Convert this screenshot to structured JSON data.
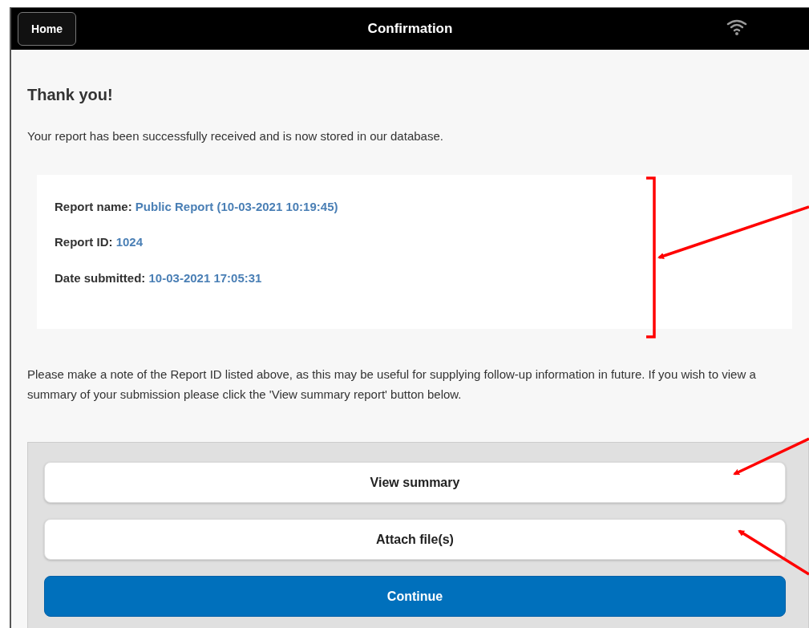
{
  "header": {
    "home_button": "Home",
    "title": "Confirmation"
  },
  "heading": "Thank you!",
  "message": "Your report has been successfully received and is now stored in our database.",
  "details": [
    {
      "label": "Report name:",
      "value": "Public Report (10-03-2021 10:19:45)"
    },
    {
      "label": "Report ID:",
      "value": "1024"
    },
    {
      "label": "Date submitted:",
      "value": "10-03-2021 17:05:31"
    }
  ],
  "note": "Please make a note of the Report ID listed above, as this may be useful for supplying follow-up information in future. If you wish to view a summary of your submission please click the 'View summary report' button below.",
  "buttons": [
    {
      "label": "View summary",
      "kind": "default"
    },
    {
      "label": "Attach file(s)",
      "kind": "default"
    },
    {
      "label": "Continue",
      "kind": "primary"
    }
  ]
}
